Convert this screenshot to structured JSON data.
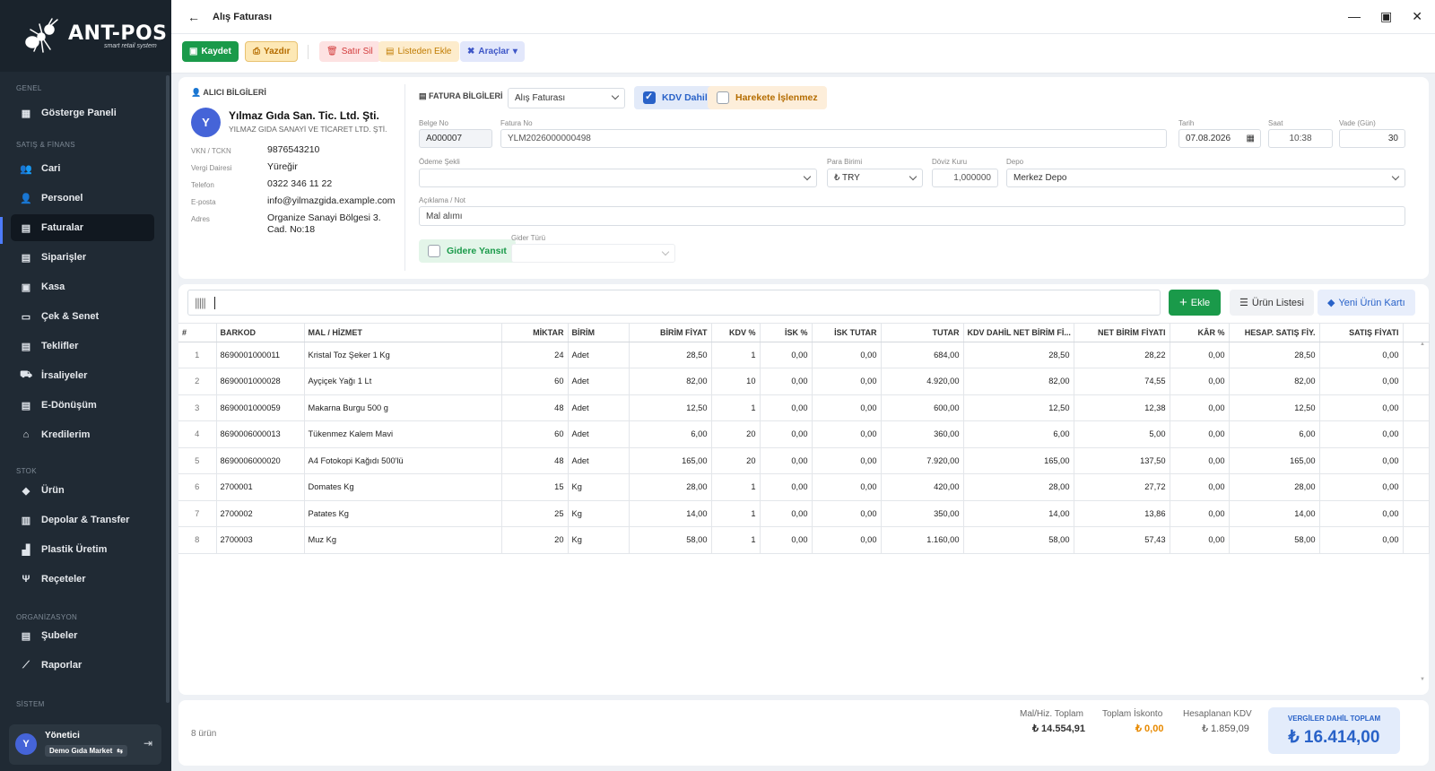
{
  "app": {
    "logo_name": "ANT-POS",
    "logo_sub": "smart retail system"
  },
  "sidebar": {
    "sections": {
      "genel": "GENEL",
      "satis": "SATIŞ & FİNANS",
      "stok": "STOK",
      "org": "ORGANİZASYON",
      "sistem": "SİSTEM"
    },
    "items": [
      {
        "label": "Gösterge Paneli",
        "icon": "dashboard-icon"
      },
      {
        "label": "Cari",
        "icon": "users-icon"
      },
      {
        "label": "Personel",
        "icon": "user-tie-icon"
      },
      {
        "label": "Faturalar",
        "icon": "invoice-icon"
      },
      {
        "label": "Siparişler",
        "icon": "order-icon"
      },
      {
        "label": "Kasa",
        "icon": "cash-register-icon"
      },
      {
        "label": "Çek & Senet",
        "icon": "check-icon"
      },
      {
        "label": "Teklifler",
        "icon": "offer-icon"
      },
      {
        "label": "İrsaliyeler",
        "icon": "truck-icon"
      },
      {
        "label": "E-Dönüşüm",
        "icon": "e-document-icon"
      },
      {
        "label": "Kredilerim",
        "icon": "bank-icon"
      },
      {
        "label": "Ürün",
        "icon": "tag-icon"
      },
      {
        "label": "Depolar & Transfer",
        "icon": "warehouse-icon"
      },
      {
        "label": "Plastik Üretim",
        "icon": "factory-icon"
      },
      {
        "label": "Reçeteler",
        "icon": "utensils-icon"
      },
      {
        "label": "Şubeler",
        "icon": "branch-icon"
      },
      {
        "label": "Raporlar",
        "icon": "chart-icon"
      }
    ],
    "user": {
      "name": "Yönetici",
      "initial": "Y",
      "company": "Demo Gıda Market"
    }
  },
  "window": {
    "title": "Alış Faturası"
  },
  "toolbar": {
    "save": "Kaydet",
    "print": "Yazdır",
    "delete_row": "Satır Sil",
    "add_from_list": "Listeden Ekle",
    "tools": "Araçlar"
  },
  "buyer": {
    "section_title": "ALICI BİLGİLERİ",
    "initial": "Y",
    "name": "Yılmaz Gıda San. Tic. Ltd. Şti.",
    "full_name": "YILMAZ GIDA SANAYİ VE TİCARET LTD. ŞTİ.",
    "fields": [
      {
        "label": "VKN / TCKN",
        "value": "9876543210"
      },
      {
        "label": "Vergi Dairesi",
        "value": "Yüreğir"
      },
      {
        "label": "Telefon",
        "value": "0322 346 11 22"
      },
      {
        "label": "E-posta",
        "value": "info@yilmazgida.example.com"
      },
      {
        "label": "Adres",
        "value": "Organize Sanayi Bölgesi 3. Cad. No:18"
      }
    ]
  },
  "invoice": {
    "section_title": "FATURA BİLGİLERİ",
    "type": "Alış Faturası",
    "kdv_included": "KDV Dahil",
    "not_processed": "Harekete İşlenmez",
    "belge_no_label": "Belge No",
    "belge_no": "A000007",
    "fatura_no_label": "Fatura No",
    "fatura_no": "YLM2026000000498",
    "tarih_label": "Tarih",
    "tarih": "07.08.2026",
    "saat_label": "Saat",
    "saat": "10:38",
    "vade_label": "Vade (Gün)",
    "vade": "30",
    "odeme_label": "Ödeme Şekli",
    "odeme": "",
    "para_label": "Para Birimi",
    "para": "₺ TRY",
    "doviz_label": "Döviz Kuru",
    "doviz": "1,000000",
    "depo_label": "Depo",
    "depo": "Merkez Depo",
    "aciklama_label": "Açıklama / Not",
    "aciklama": "Mal alımı",
    "gidere_yansit": "Gidere Yansıt",
    "gider_turu_label": "Gider Türü"
  },
  "barcode": {
    "add": "Ekle",
    "product_list": "Ürün Listesi",
    "new_product": "Yeni Ürün Kartı"
  },
  "table": {
    "headers": [
      "#",
      "BARKOD",
      "MAL / HİZMET",
      "MİKTAR",
      "BİRİM",
      "BİRİM FİYAT",
      "KDV %",
      "İSK %",
      "İSK TUTAR",
      "TUTAR",
      "KDV DAHİL NET BİRİM Fİ...",
      "NET BİRİM FİYATI",
      "KÂR %",
      "HESAP. SATIŞ FİY.",
      "SATIŞ FİYATI"
    ],
    "rows": [
      [
        "1",
        "8690001000011",
        "Kristal Toz Şeker 1 Kg",
        "24",
        "Adet",
        "28,50",
        "1",
        "0,00",
        "0,00",
        "684,00",
        "28,50",
        "28,22",
        "0,00",
        "28,50",
        "0,00"
      ],
      [
        "2",
        "8690001000028",
        "Ayçiçek Yağı 1 Lt",
        "60",
        "Adet",
        "82,00",
        "10",
        "0,00",
        "0,00",
        "4.920,00",
        "82,00",
        "74,55",
        "0,00",
        "82,00",
        "0,00"
      ],
      [
        "3",
        "8690001000059",
        "Makarna Burgu 500 g",
        "48",
        "Adet",
        "12,50",
        "1",
        "0,00",
        "0,00",
        "600,00",
        "12,50",
        "12,38",
        "0,00",
        "12,50",
        "0,00"
      ],
      [
        "4",
        "8690006000013",
        "Tükenmez Kalem Mavi",
        "60",
        "Adet",
        "6,00",
        "20",
        "0,00",
        "0,00",
        "360,00",
        "6,00",
        "5,00",
        "0,00",
        "6,00",
        "0,00"
      ],
      [
        "5",
        "8690006000020",
        "A4 Fotokopi Kağıdı 500'lü",
        "48",
        "Adet",
        "165,00",
        "20",
        "0,00",
        "0,00",
        "7.920,00",
        "165,00",
        "137,50",
        "0,00",
        "165,00",
        "0,00"
      ],
      [
        "6",
        "2700001",
        "Domates Kg",
        "15",
        "Kg",
        "28,00",
        "1",
        "0,00",
        "0,00",
        "420,00",
        "28,00",
        "27,72",
        "0,00",
        "28,00",
        "0,00"
      ],
      [
        "7",
        "2700002",
        "Patates Kg",
        "25",
        "Kg",
        "14,00",
        "1",
        "0,00",
        "0,00",
        "350,00",
        "14,00",
        "13,86",
        "0,00",
        "14,00",
        "0,00"
      ],
      [
        "8",
        "2700003",
        "Muz Kg",
        "20",
        "Kg",
        "58,00",
        "1",
        "0,00",
        "0,00",
        "1.160,00",
        "58,00",
        "57,43",
        "0,00",
        "58,00",
        "0,00"
      ]
    ]
  },
  "footer": {
    "count": "8 ürün",
    "mal_label": "Mal/Hiz. Toplam",
    "mal": "₺ 14.554,91",
    "iskonto_label": "Toplam İskonto",
    "iskonto": "₺ 0,00",
    "kdv_label": "Hesaplanan KDV",
    "kdv": "₺ 1.859,09",
    "grand_label": "VERGİLER DAHİL TOPLAM",
    "grand": "₺ 16.414,00"
  },
  "colors": {
    "sidebar": "#202a34",
    "accent_green": "#1a9a4a",
    "accent_blue": "#2962c8",
    "orange": "#e88a00"
  }
}
